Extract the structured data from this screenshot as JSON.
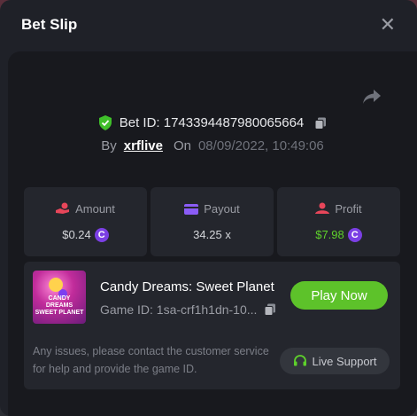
{
  "modal": {
    "title": "Bet Slip"
  },
  "bet": {
    "id_label": "Bet ID: 1743394487980065664",
    "by_label": "By",
    "user": "xrflive",
    "on_label": "On",
    "date": "08/09/2022, 10:49:06"
  },
  "stats": {
    "amount": {
      "label": "Amount",
      "value": "$0.24"
    },
    "payout": {
      "label": "Payout",
      "value": "34.25 x"
    },
    "profit": {
      "label": "Profit",
      "value": "$7.98"
    }
  },
  "game": {
    "name": "Candy Dreams: Sweet Planet",
    "id_label": "Game ID: 1sa-crf1h1dn-10...",
    "thumb_text": "CANDY DREAMS SWEET PLANET",
    "play_label": "Play Now"
  },
  "support": {
    "notice": "Any issues, please contact the customer service for help and provide the game ID.",
    "button_label": "Live Support"
  },
  "colors": {
    "accent": "#5dc22a",
    "coin": "#7b3fe4",
    "profit": "#5ed12b"
  }
}
